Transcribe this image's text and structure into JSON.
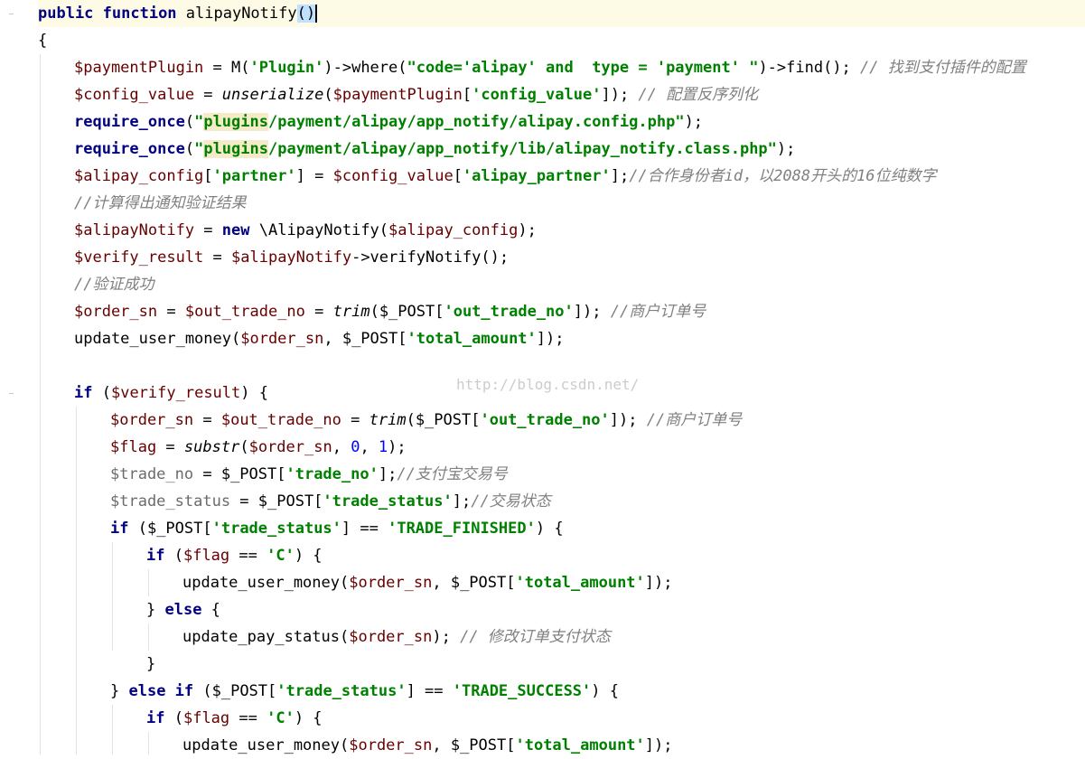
{
  "editor": {
    "watermark": "http://blog.csdn.net/",
    "lines": [
      {
        "indent": 0,
        "current": true,
        "tokens": [
          {
            "t": "public ",
            "c": "kw"
          },
          {
            "t": "function ",
            "c": "kw"
          },
          {
            "t": "alipayNotify",
            "c": "fn"
          },
          {
            "t": "()",
            "c": "caret"
          }
        ]
      },
      {
        "indent": 0,
        "tokens": [
          {
            "t": "{",
            "c": "op"
          }
        ]
      },
      {
        "indent": 1,
        "tokens": [
          {
            "t": "$paymentPlugin",
            "c": "var"
          },
          {
            "t": " = M(",
            "c": "op"
          },
          {
            "t": "'Plugin'",
            "c": "str"
          },
          {
            "t": ")->where(",
            "c": "op"
          },
          {
            "t": "\"code='alipay' and  type = 'payment' \"",
            "c": "str"
          },
          {
            "t": ")->find(); ",
            "c": "op"
          },
          {
            "t": "// 找到支付插件的配置",
            "c": "cmt"
          }
        ]
      },
      {
        "indent": 1,
        "tokens": [
          {
            "t": "$config_value",
            "c": "var"
          },
          {
            "t": " = ",
            "c": "op"
          },
          {
            "t": "unserialize",
            "c": "ifn"
          },
          {
            "t": "(",
            "c": "op"
          },
          {
            "t": "$paymentPlugin",
            "c": "var"
          },
          {
            "t": "[",
            "c": "op"
          },
          {
            "t": "'config_value'",
            "c": "str"
          },
          {
            "t": "]); ",
            "c": "op"
          },
          {
            "t": "// 配置反序列化",
            "c": "cmt"
          }
        ]
      },
      {
        "indent": 1,
        "tokens": [
          {
            "t": "require_once",
            "c": "kw"
          },
          {
            "t": "(",
            "c": "op"
          },
          {
            "t": "\"",
            "c": "str"
          },
          {
            "t": "plugins",
            "c": "strhl"
          },
          {
            "t": "/payment/alipay/app_notify/alipay.config.php\"",
            "c": "str"
          },
          {
            "t": ");",
            "c": "op"
          }
        ]
      },
      {
        "indent": 1,
        "tokens": [
          {
            "t": "require_once",
            "c": "kw"
          },
          {
            "t": "(",
            "c": "op"
          },
          {
            "t": "\"",
            "c": "str"
          },
          {
            "t": "plugins",
            "c": "strhl"
          },
          {
            "t": "/payment/alipay/app_notify/lib/alipay_notify.class.php\"",
            "c": "str"
          },
          {
            "t": ");",
            "c": "op"
          }
        ]
      },
      {
        "indent": 1,
        "tokens": [
          {
            "t": "$alipay_config",
            "c": "var"
          },
          {
            "t": "[",
            "c": "op"
          },
          {
            "t": "'partner'",
            "c": "str"
          },
          {
            "t": "] = ",
            "c": "op"
          },
          {
            "t": "$config_value",
            "c": "var"
          },
          {
            "t": "[",
            "c": "op"
          },
          {
            "t": "'alipay_partner'",
            "c": "str"
          },
          {
            "t": "];",
            "c": "op"
          },
          {
            "t": "//合作身份者id，以2088开头的16位纯数字",
            "c": "cmt"
          }
        ]
      },
      {
        "indent": 1,
        "tokens": [
          {
            "t": "//计算得出通知验证结果",
            "c": "cmt"
          }
        ]
      },
      {
        "indent": 1,
        "tokens": [
          {
            "t": "$alipayNotify",
            "c": "var"
          },
          {
            "t": " = ",
            "c": "op"
          },
          {
            "t": "new ",
            "c": "kw"
          },
          {
            "t": "\\AlipayNotify(",
            "c": "op"
          },
          {
            "t": "$alipay_config",
            "c": "var"
          },
          {
            "t": ");",
            "c": "op"
          }
        ]
      },
      {
        "indent": 1,
        "tokens": [
          {
            "t": "$verify_result",
            "c": "var"
          },
          {
            "t": " = ",
            "c": "op"
          },
          {
            "t": "$alipayNotify",
            "c": "var"
          },
          {
            "t": "->verifyNotify();",
            "c": "op"
          }
        ]
      },
      {
        "indent": 1,
        "tokens": [
          {
            "t": "//验证成功",
            "c": "cmt"
          }
        ]
      },
      {
        "indent": 1,
        "tokens": [
          {
            "t": "$order_sn",
            "c": "var"
          },
          {
            "t": " = ",
            "c": "op"
          },
          {
            "t": "$out_trade_no",
            "c": "var"
          },
          {
            "t": " = ",
            "c": "op"
          },
          {
            "t": "trim",
            "c": "ifn"
          },
          {
            "t": "($_POST[",
            "c": "op"
          },
          {
            "t": "'out_trade_no'",
            "c": "str"
          },
          {
            "t": "]); ",
            "c": "op"
          },
          {
            "t": "//商户订单号",
            "c": "cmt"
          }
        ]
      },
      {
        "indent": 1,
        "tokens": [
          {
            "t": "update_user_money(",
            "c": "op"
          },
          {
            "t": "$order_sn",
            "c": "var"
          },
          {
            "t": ", $_POST[",
            "c": "op"
          },
          {
            "t": "'total_amount'",
            "c": "str"
          },
          {
            "t": "]);",
            "c": "op"
          }
        ]
      },
      {
        "indent": 1,
        "tokens": []
      },
      {
        "indent": 1,
        "tokens": [
          {
            "t": "if ",
            "c": "kw"
          },
          {
            "t": "(",
            "c": "op"
          },
          {
            "t": "$verify_result",
            "c": "var"
          },
          {
            "t": ") {",
            "c": "op"
          }
        ]
      },
      {
        "indent": 2,
        "tokens": [
          {
            "t": "$order_sn",
            "c": "var"
          },
          {
            "t": " = ",
            "c": "op"
          },
          {
            "t": "$out_trade_no",
            "c": "var"
          },
          {
            "t": " = ",
            "c": "op"
          },
          {
            "t": "trim",
            "c": "ifn"
          },
          {
            "t": "($_POST[",
            "c": "op"
          },
          {
            "t": "'out_trade_no'",
            "c": "str"
          },
          {
            "t": "]); ",
            "c": "op"
          },
          {
            "t": "//商户订单号",
            "c": "cmt"
          }
        ]
      },
      {
        "indent": 2,
        "tokens": [
          {
            "t": "$flag",
            "c": "var"
          },
          {
            "t": " = ",
            "c": "op"
          },
          {
            "t": "substr",
            "c": "ifn"
          },
          {
            "t": "(",
            "c": "op"
          },
          {
            "t": "$order_sn",
            "c": "var"
          },
          {
            "t": ", ",
            "c": "op"
          },
          {
            "t": "0",
            "c": "num"
          },
          {
            "t": ", ",
            "c": "op"
          },
          {
            "t": "1",
            "c": "num"
          },
          {
            "t": ");",
            "c": "op"
          }
        ]
      },
      {
        "indent": 2,
        "tokens": [
          {
            "t": "$trade_no",
            "c": "gvar"
          },
          {
            "t": " = $_POST[",
            "c": "op"
          },
          {
            "t": "'trade_no'",
            "c": "str"
          },
          {
            "t": "];",
            "c": "op"
          },
          {
            "t": "//支付宝交易号",
            "c": "cmt"
          }
        ]
      },
      {
        "indent": 2,
        "tokens": [
          {
            "t": "$trade_status",
            "c": "gvar"
          },
          {
            "t": " = $_POST[",
            "c": "op"
          },
          {
            "t": "'trade_status'",
            "c": "str"
          },
          {
            "t": "];",
            "c": "op"
          },
          {
            "t": "//交易状态",
            "c": "cmt"
          }
        ]
      },
      {
        "indent": 2,
        "tokens": [
          {
            "t": "if ",
            "c": "kw"
          },
          {
            "t": "($_POST[",
            "c": "op"
          },
          {
            "t": "'trade_status'",
            "c": "str"
          },
          {
            "t": "] == ",
            "c": "op"
          },
          {
            "t": "'TRADE_FINISHED'",
            "c": "str"
          },
          {
            "t": ") {",
            "c": "op"
          }
        ]
      },
      {
        "indent": 3,
        "tokens": [
          {
            "t": "if ",
            "c": "kw"
          },
          {
            "t": "(",
            "c": "op"
          },
          {
            "t": "$flag",
            "c": "var"
          },
          {
            "t": " == ",
            "c": "op"
          },
          {
            "t": "'C'",
            "c": "str"
          },
          {
            "t": ") {",
            "c": "op"
          }
        ]
      },
      {
        "indent": 4,
        "tokens": [
          {
            "t": "update_user_money(",
            "c": "op"
          },
          {
            "t": "$order_sn",
            "c": "var"
          },
          {
            "t": ", $_POST[",
            "c": "op"
          },
          {
            "t": "'total_amount'",
            "c": "str"
          },
          {
            "t": "]);",
            "c": "op"
          }
        ]
      },
      {
        "indent": 3,
        "tokens": [
          {
            "t": "} ",
            "c": "op"
          },
          {
            "t": "else ",
            "c": "kw"
          },
          {
            "t": "{",
            "c": "op"
          }
        ]
      },
      {
        "indent": 4,
        "tokens": [
          {
            "t": "update_pay_status(",
            "c": "op"
          },
          {
            "t": "$order_sn",
            "c": "var"
          },
          {
            "t": "); ",
            "c": "op"
          },
          {
            "t": "// 修改订单支付状态",
            "c": "cmt"
          }
        ]
      },
      {
        "indent": 3,
        "tokens": [
          {
            "t": "}",
            "c": "op"
          }
        ]
      },
      {
        "indent": 2,
        "tokens": [
          {
            "t": "} ",
            "c": "op"
          },
          {
            "t": "else if ",
            "c": "kw"
          },
          {
            "t": "($_POST[",
            "c": "op"
          },
          {
            "t": "'trade_status'",
            "c": "str"
          },
          {
            "t": "] == ",
            "c": "op"
          },
          {
            "t": "'TRADE_SUCCESS'",
            "c": "str"
          },
          {
            "t": ") {",
            "c": "op"
          }
        ]
      },
      {
        "indent": 3,
        "tokens": [
          {
            "t": "if ",
            "c": "kw"
          },
          {
            "t": "(",
            "c": "op"
          },
          {
            "t": "$flag",
            "c": "var"
          },
          {
            "t": " == ",
            "c": "op"
          },
          {
            "t": "'C'",
            "c": "str"
          },
          {
            "t": ") {",
            "c": "op"
          }
        ]
      },
      {
        "indent": 4,
        "tokens": [
          {
            "t": "update_user_money(",
            "c": "op"
          },
          {
            "t": "$order_sn",
            "c": "var"
          },
          {
            "t": ", $_POST[",
            "c": "op"
          },
          {
            "t": "'total_amount'",
            "c": "str"
          },
          {
            "t": "]);",
            "c": "op"
          }
        ]
      }
    ]
  }
}
